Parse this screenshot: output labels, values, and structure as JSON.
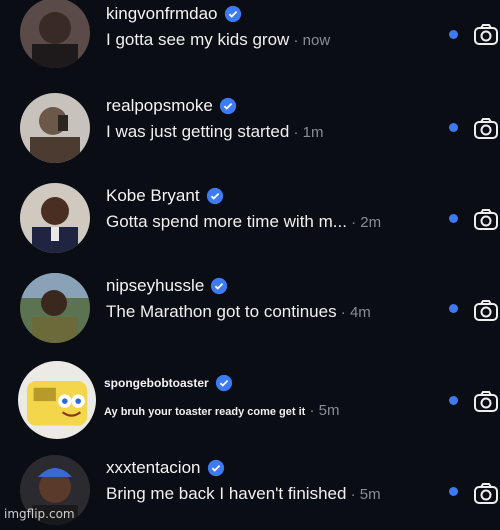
{
  "messages": [
    {
      "username": "kingvonfrmdao",
      "message": "I gotta see my kids grow",
      "time": "now",
      "verified": true,
      "unread": true
    },
    {
      "username": "realpopsmoke",
      "message": "I was just getting started",
      "time": "1m",
      "verified": true,
      "unread": true
    },
    {
      "username": "Kobe Bryant",
      "message": "Gotta spend more time with m...",
      "time": "2m",
      "verified": true,
      "unread": true
    },
    {
      "username": "nipseyhussle",
      "message": "The Marathon got to continues",
      "time": "4m",
      "verified": true,
      "unread": true
    },
    {
      "username": "spongebobtoaster",
      "message": "Ay bruh your toaster ready come get it",
      "time": "5m",
      "verified": true,
      "unread": true
    },
    {
      "username": "xxxtentacion",
      "message": "Bring me back I haven't finished",
      "time": "5m",
      "verified": true,
      "unread": true
    }
  ],
  "separator": " · ",
  "watermark": "imgflip.com",
  "colors": {
    "background": "#0b0d14",
    "unread_dot": "#3d7bf5",
    "verified": "#3d7bf5",
    "timestamp": "#8a8c93"
  }
}
